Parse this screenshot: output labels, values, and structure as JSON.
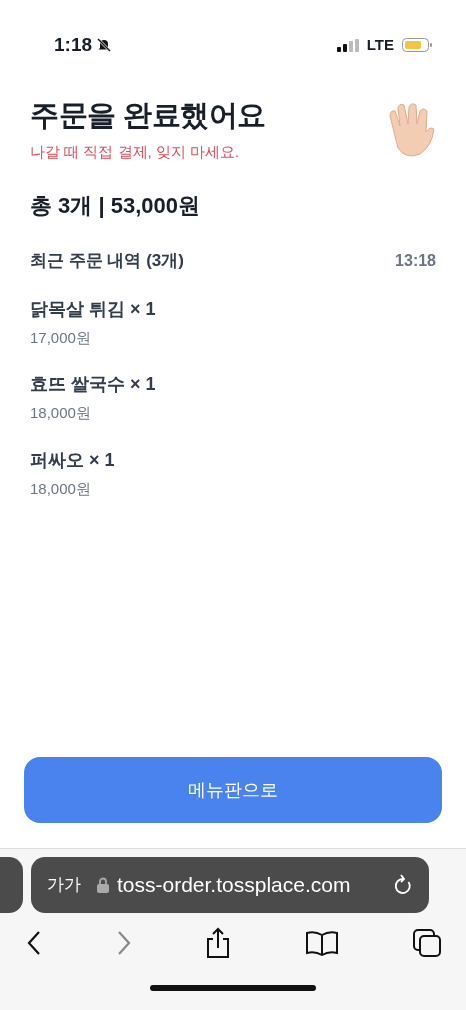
{
  "status_bar": {
    "time": "1:18",
    "network": "LTE"
  },
  "header": {
    "title": "주문을 완료했어요",
    "subtitle": "나갈 때 직접 결제, 잊지 마세요."
  },
  "summary": "총 3개 | 53,000원",
  "recent_orders": {
    "heading": "최근 주문 내역 (3개)",
    "time": "13:18",
    "items": [
      {
        "name": "닭목살 튀김 × 1",
        "price": "17,000원"
      },
      {
        "name": "효뜨 쌀국수 × 1",
        "price": "18,000원"
      },
      {
        "name": "퍼싸오 × 1",
        "price": "18,000원"
      }
    ]
  },
  "menu_button": "메뉴판으로",
  "browser": {
    "text_size": "가가",
    "url": "toss-order.tossplace.com"
  }
}
